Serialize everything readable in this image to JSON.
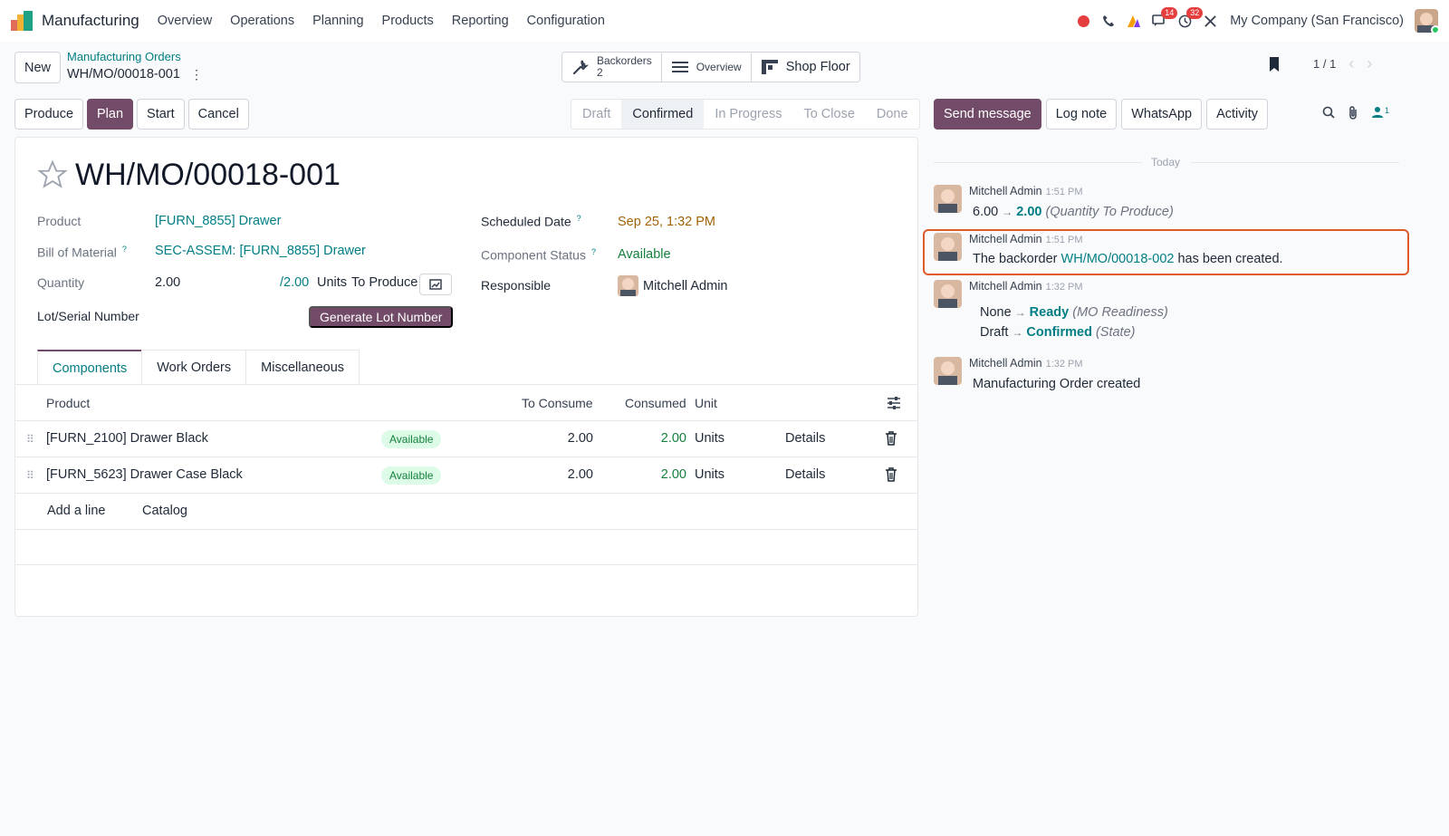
{
  "topnav": {
    "app_name": "Manufacturing",
    "menu": [
      "Overview",
      "Operations",
      "Planning",
      "Products",
      "Reporting",
      "Configuration"
    ],
    "chat_badge": "14",
    "activity_badge": "32",
    "company": "My Company (San Francisco)"
  },
  "control": {
    "new_label": "New",
    "breadcrumb_parent": "Manufacturing Orders",
    "breadcrumb_current": "WH/MO/00018-001",
    "smart_backorders_label": "Backorders",
    "smart_backorders_count": "2",
    "smart_overview_label": "Overview",
    "smart_shopfloor_label": "Shop Floor",
    "pager": "1 / 1"
  },
  "actions": {
    "produce": "Produce",
    "plan": "Plan",
    "start": "Start",
    "cancel": "Cancel"
  },
  "statusbar": {
    "stages": [
      "Draft",
      "Confirmed",
      "In Progress",
      "To Close",
      "Done"
    ],
    "active": "Confirmed"
  },
  "form": {
    "title": "WH/MO/00018-001",
    "product_label": "Product",
    "product_value": "[FURN_8855] Drawer",
    "bom_label": "Bill of Material",
    "bom_value": "SEC-ASSEM: [FURN_8855] Drawer",
    "quantity_label": "Quantity",
    "quantity_value": "2.00",
    "quantity_produced": "/2.00",
    "quantity_units": "Units",
    "quantity_suffix": "To Produce",
    "lot_label": "Lot/Serial Number",
    "generate_lot": "Generate Lot Number",
    "scheduled_label": "Scheduled Date",
    "scheduled_value": "Sep 25, 1:32 PM",
    "component_status_label": "Component Status",
    "component_status_value": "Available",
    "responsible_label": "Responsible",
    "responsible_value": "Mitchell Admin",
    "help_mark": "?"
  },
  "tabs": [
    "Components",
    "Work Orders",
    "Miscellaneous"
  ],
  "components": {
    "headers": {
      "product": "Product",
      "to_consume": "To Consume",
      "consumed": "Consumed",
      "unit": "Unit"
    },
    "rows": [
      {
        "product": "[FURN_2100] Drawer Black",
        "status": "Available",
        "to_consume": "2.00",
        "consumed": "2.00",
        "unit": "Units",
        "details": "Details"
      },
      {
        "product": "[FURN_5623] Drawer Case Black",
        "status": "Available",
        "to_consume": "2.00",
        "consumed": "2.00",
        "unit": "Units",
        "details": "Details"
      }
    ],
    "add_line": "Add a line",
    "catalog": "Catalog"
  },
  "chatter": {
    "send_message": "Send message",
    "log_note": "Log note",
    "whatsapp": "WhatsApp",
    "activity": "Activity",
    "followers_count": "1",
    "today": "Today",
    "messages": [
      {
        "author": "Mitchell Admin",
        "time": "1:51 PM",
        "old": "6.00",
        "new": "2.00",
        "field": "(Quantity To Produce)"
      },
      {
        "author": "Mitchell Admin",
        "time": "1:51 PM",
        "prefix": "The backorder",
        "link": "WH/MO/00018-002",
        "suffix": "has been created."
      },
      {
        "author": "Mitchell Admin",
        "time": "1:32 PM",
        "old1": "None",
        "new1": "Ready",
        "field1": "(MO Readiness)",
        "old2": "Draft",
        "new2": "Confirmed",
        "field2": "(State)"
      },
      {
        "author": "Mitchell Admin",
        "time": "1:32 PM",
        "body": "Manufacturing Order created"
      }
    ]
  },
  "colors": {
    "brand": "#714b67",
    "link": "#017e84",
    "success": "#15803d",
    "highlight": "#e05a2b"
  }
}
